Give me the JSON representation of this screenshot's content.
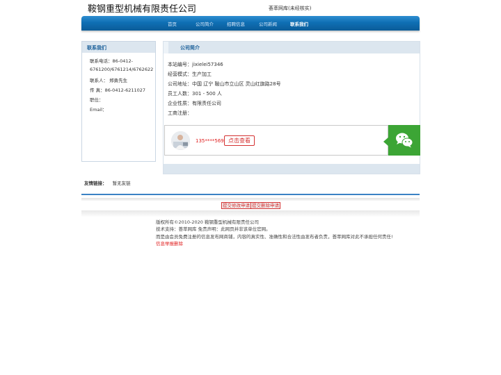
{
  "header": {
    "company_name": "鞍钢重型机械有限责任公司",
    "note": "荟萃网库(未经核实)"
  },
  "nav": {
    "items": [
      "首页",
      "公司简介",
      "招聘信息",
      "公司新闻",
      "联系我们"
    ],
    "active": "联系我们"
  },
  "sidebar": {
    "title": "联系我们",
    "lines": [
      "联系电话：86-0412-",
      "6761200/6761214/6762622",
      "联系人：  郑勇先生",
      "传  真：86-0412-6211027",
      "职位：",
      "Email："
    ]
  },
  "main": {
    "title": "公司简介",
    "info": [
      "本站编号：jixielei57346",
      "经营模式：生产加工",
      "公司地址：中国 辽宁 鞍山市立山区 灵山红旗路28号",
      "员工人数：301 - 500 人",
      "企业性质：有限责任公司",
      "工商注册："
    ],
    "contact_card": {
      "phone_masked": "135****5692",
      "view_button": "点击查看",
      "wechat_icon": "wechat-icon",
      "accent_color": "#3ca535"
    }
  },
  "links": {
    "label": "友情链接：",
    "text": "暂无友链"
  },
  "actions": {
    "submit_edit": "提交修改申请",
    "submit_delete": "提交删除申请"
  },
  "footer": {
    "copyright": "版权所有©2010-2020 鞍钢重型机械有限责任公司",
    "support": "技术支持：荟萃网库 免责声明：此网页并非该单位官网。",
    "disclaimer": "而是由会员免费注册的信息发布网商铺，内容的真实性、准确性和合法性由发布者负责，荟萃网库对此不承担任何责任!",
    "report": "信息举报删除"
  }
}
